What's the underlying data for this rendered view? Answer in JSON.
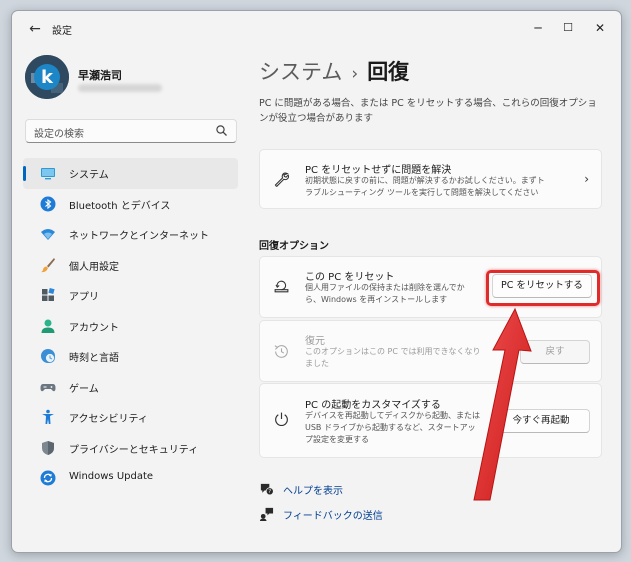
{
  "window": {
    "title": "設定",
    "back_glyph": "←",
    "minimize_glyph": "─",
    "maximize_glyph": "☐",
    "close_glyph": "✕"
  },
  "user": {
    "name": "早瀬浩司",
    "avatar_letter": "k"
  },
  "search": {
    "placeholder": "設定の検索",
    "icon": "search-icon"
  },
  "sidebar": {
    "items": [
      {
        "label": "システム",
        "icon": "system-monitor-icon",
        "active": true
      },
      {
        "label": "Bluetooth とデバイス",
        "icon": "bluetooth-icon"
      },
      {
        "label": "ネットワークとインターネット",
        "icon": "wifi-icon"
      },
      {
        "label": "個人用設定",
        "icon": "paintbrush-icon"
      },
      {
        "label": "アプリ",
        "icon": "apps-icon"
      },
      {
        "label": "アカウント",
        "icon": "account-icon"
      },
      {
        "label": "時刻と言語",
        "icon": "clock-globe-icon"
      },
      {
        "label": "ゲーム",
        "icon": "gamepad-icon"
      },
      {
        "label": "アクセシビリティ",
        "icon": "accessibility-icon"
      },
      {
        "label": "プライバシーとセキュリティ",
        "icon": "shield-icon"
      },
      {
        "label": "Windows Update",
        "icon": "windows-update-icon"
      }
    ]
  },
  "main": {
    "breadcrumb_parent": "システム",
    "breadcrumb_sep": "›",
    "breadcrumb_current": "回復",
    "description": "PC に問題がある場合、または PC をリセットする場合、これらの回復オプションが役立つ場合があります",
    "fix_card": {
      "title": "PC をリセットせずに問題を解決",
      "subtitle": "初期状態に戻すの前に、問題が解決するかお試しください。まずトラブルシューティング ツールを実行して問題を解決してください",
      "chevron": "›"
    },
    "section_label": "回復オプション",
    "reset_card": {
      "title": "この PC をリセット",
      "subtitle": "個人用ファイルの保持または削除を選んでから、Windows を再インストールします",
      "button": "PC をリセットする"
    },
    "restore_card": {
      "title": "復元",
      "subtitle": "このオプションはこの PC では利用できなくなりました",
      "button": "戻す"
    },
    "startup_card": {
      "title": "PC の起動をカスタマイズする",
      "subtitle": "デバイスを再起動してディスクから起動、または USB ドライブから起動するなど、スタートアップ設定を変更する",
      "button": "今すぐ再起動"
    },
    "links": [
      {
        "label": "ヘルプを表示",
        "icon": "help-icon"
      },
      {
        "label": "フィードバックの送信",
        "icon": "feedback-icon"
      }
    ]
  },
  "colors": {
    "accent": "#0067c0",
    "annotation_red": "#e02b2b"
  }
}
